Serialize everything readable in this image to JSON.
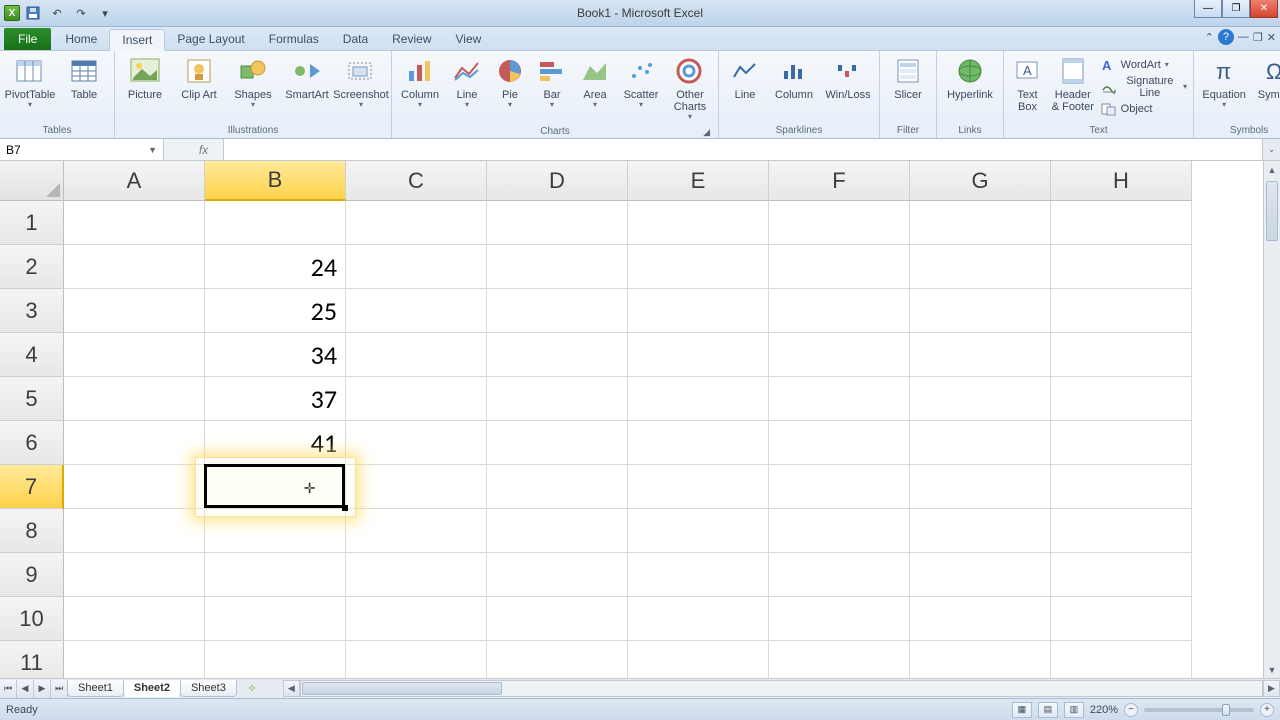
{
  "title": "Book1 - Microsoft Excel",
  "qat": {
    "save": "💾",
    "undo": "↶",
    "redo": "↷"
  },
  "tabs": {
    "file": "File",
    "list": [
      "Home",
      "Insert",
      "Page Layout",
      "Formulas",
      "Data",
      "Review",
      "View"
    ],
    "active": "Insert"
  },
  "ribbon": {
    "tables": {
      "label": "Tables",
      "pivot": "PivotTable",
      "table": "Table"
    },
    "illustrations": {
      "label": "Illustrations",
      "picture": "Picture",
      "clipart": "Clip Art",
      "shapes": "Shapes",
      "smartart": "SmartArt",
      "screenshot": "Screenshot"
    },
    "charts": {
      "label": "Charts",
      "column": "Column",
      "line": "Line",
      "pie": "Pie",
      "bar": "Bar",
      "area": "Area",
      "scatter": "Scatter",
      "other": "Other Charts"
    },
    "sparklines": {
      "label": "Sparklines",
      "line": "Line",
      "column": "Column",
      "winloss": "Win/Loss"
    },
    "filter": {
      "label": "Filter",
      "slicer": "Slicer"
    },
    "links": {
      "label": "Links",
      "hyperlink": "Hyperlink"
    },
    "text": {
      "label": "Text",
      "textbox": "Text Box",
      "headerfooter": "Header & Footer",
      "wordart": "WordArt",
      "sigline": "Signature Line",
      "object": "Object"
    },
    "symbols": {
      "label": "Symbols",
      "equation": "Equation",
      "symbol": "Symbol"
    }
  },
  "namebox": "B7",
  "formula": "",
  "columns": [
    "A",
    "B",
    "C",
    "D",
    "E",
    "F",
    "G",
    "H"
  ],
  "active_col_index": 1,
  "rows": [
    "1",
    "2",
    "3",
    "4",
    "5",
    "6",
    "7",
    "8",
    "9",
    "10",
    "11"
  ],
  "active_row_index": 6,
  "cells": {
    "B2": "24",
    "B3": "25",
    "B4": "34",
    "B5": "37",
    "B6": "41"
  },
  "selection": {
    "col": 1,
    "row": 6
  },
  "sheets": {
    "list": [
      "Sheet1",
      "Sheet2",
      "Sheet3"
    ],
    "active": "Sheet2"
  },
  "status": {
    "ready": "Ready",
    "zoom": "220%"
  }
}
